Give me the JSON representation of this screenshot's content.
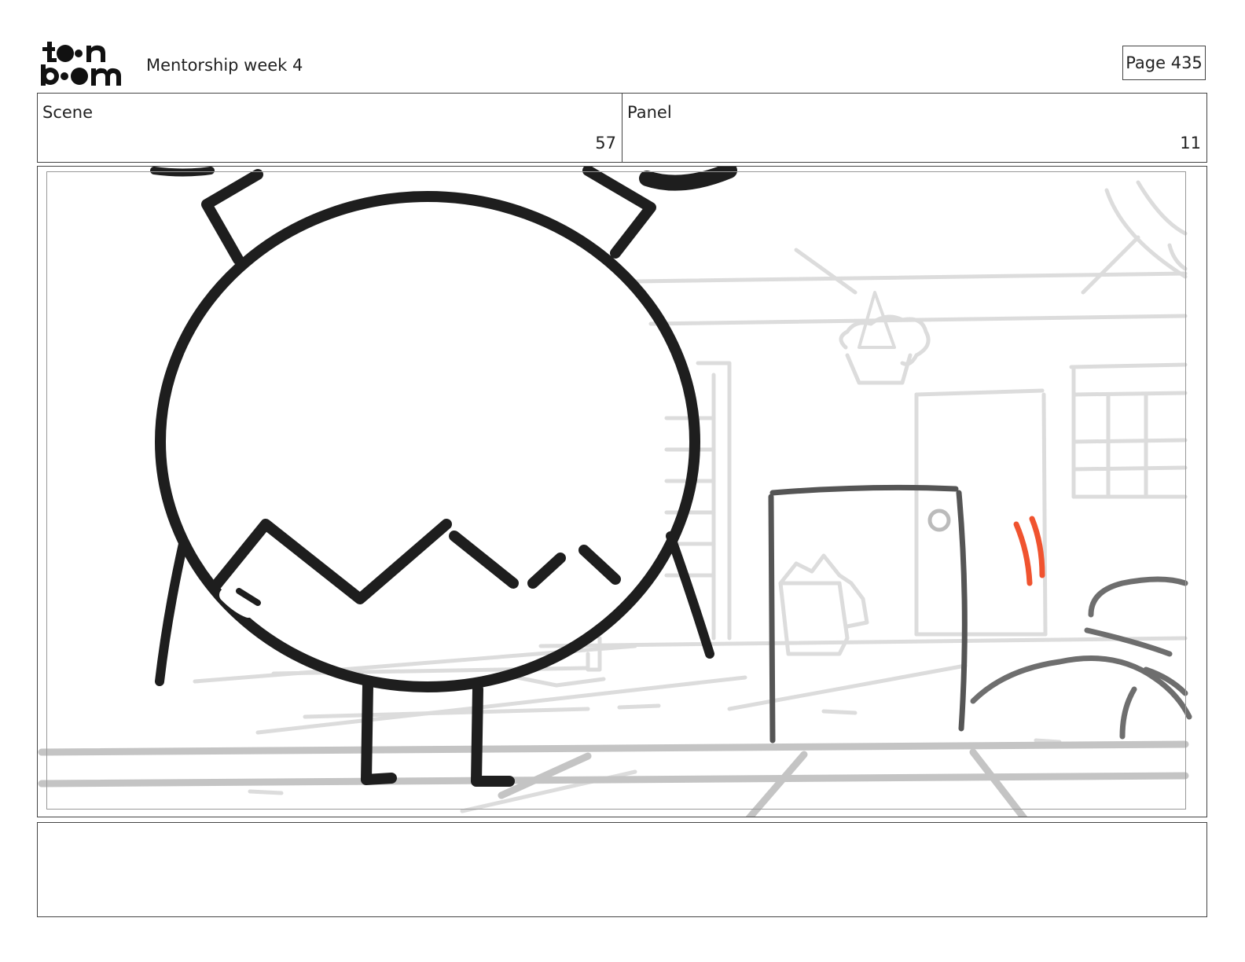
{
  "header": {
    "logo_text": "toon boom",
    "document_title": "Mentorship week 4",
    "page_label": "Page 435"
  },
  "info": {
    "scene_label": "Scene",
    "scene_value": "57",
    "panel_label": "Panel",
    "panel_value": "11"
  },
  "drawing": {
    "description_icon": "storyboard-sketch",
    "accent_color": "#f0532f",
    "ink_color": "#1e1e1e",
    "background_sketch_color": "#c8c8c8"
  },
  "notes": {
    "text": ""
  }
}
